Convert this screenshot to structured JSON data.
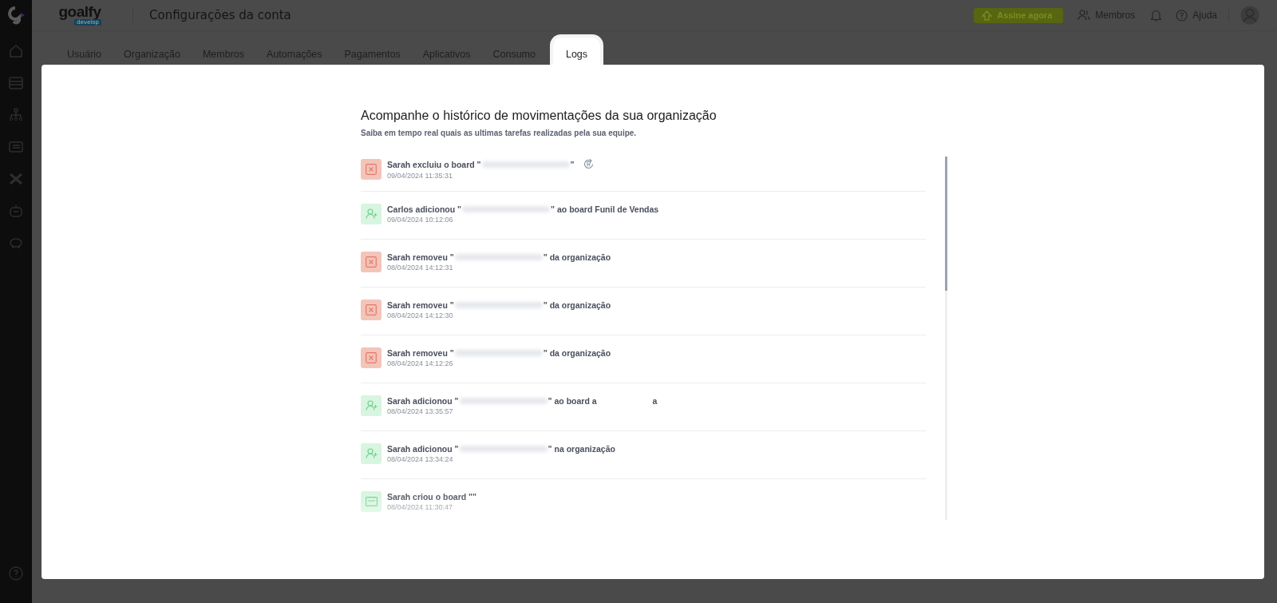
{
  "header": {
    "logo": "goalfy",
    "logo_badge": "develop",
    "title": "Configurações da conta",
    "upgrade_button": "Assine agora",
    "members_link": "Membros",
    "help_link": "Ajuda"
  },
  "tabs": [
    {
      "label": "Usuário",
      "selected": false
    },
    {
      "label": "Organização",
      "selected": false
    },
    {
      "label": "Membros",
      "selected": false
    },
    {
      "label": "Automações",
      "selected": false
    },
    {
      "label": "Pagamentos",
      "selected": false
    },
    {
      "label": "Aplicativos",
      "selected": false
    },
    {
      "label": "Consumo",
      "selected": false
    },
    {
      "label": "Logs",
      "selected": true
    }
  ],
  "logs": {
    "title": "Acompanhe o histórico de movimentações da sua organização",
    "subtitle": "Saiba em tempo real quais as ultimas tarefas realizadas pela sua equipe.",
    "entries": [
      {
        "kind": "delete",
        "before": "Sarah excluiu o board \"",
        "redacted": true,
        "after": "\"",
        "restore": true,
        "time": "09/04/2024 11:35:31"
      },
      {
        "kind": "add",
        "before": "Carlos adicionou \"",
        "redacted": true,
        "after": "\" ao board Funil de Vendas",
        "time": "09/04/2024 10:12:06"
      },
      {
        "kind": "delete",
        "before": "Sarah removeu \"",
        "redacted": true,
        "after": "\" da organização",
        "time": "08/04/2024 14:12:31"
      },
      {
        "kind": "delete",
        "before": "Sarah removeu \"",
        "redacted": true,
        "after": "\" da organização",
        "time": "08/04/2024 14:12:30"
      },
      {
        "kind": "delete",
        "before": "Sarah removeu \"",
        "redacted": true,
        "after": "\" da organização",
        "time": "08/04/2024 14:12:26"
      },
      {
        "kind": "add",
        "before": "Sarah adicionou \"",
        "redacted": true,
        "after": "\" ao board a",
        "tail": "a",
        "time": "08/04/2024 13:35:57"
      },
      {
        "kind": "add",
        "before": "Sarah adicionou \"",
        "redacted": true,
        "after": "\" na organização",
        "time": "08/04/2024 13:34:24"
      },
      {
        "kind": "board",
        "before": "Sarah criou o board \"\"",
        "time": "08/04/2024 11:30:47"
      }
    ]
  }
}
